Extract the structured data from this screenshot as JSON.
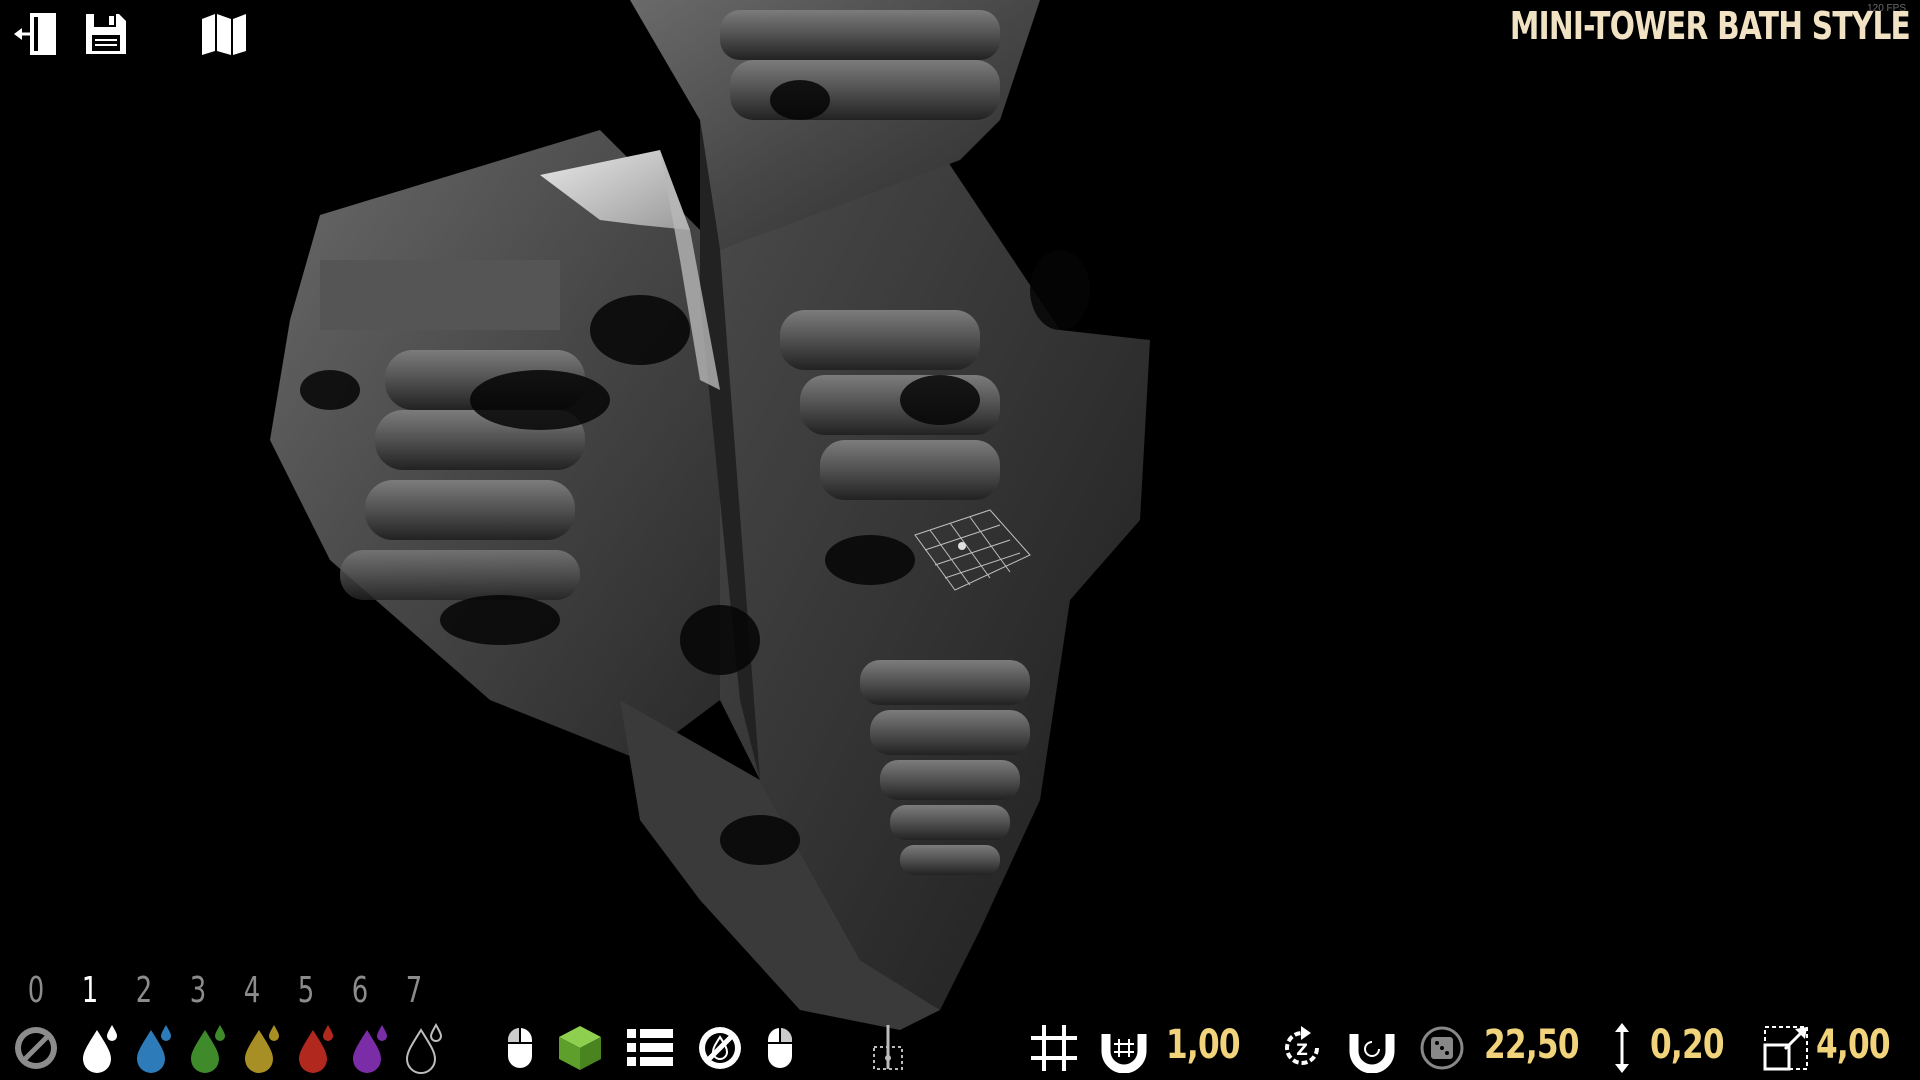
{
  "header": {
    "title": "MINI-TOWER BATH STYLE",
    "fps": "120 FPS"
  },
  "toolbar": {
    "exit_icon": "exit-door-icon",
    "save_icon": "floppy-save-icon",
    "map_icon": "map-icon"
  },
  "paint_slots": [
    {
      "number": "0",
      "color": "none"
    },
    {
      "number": "1",
      "color": "#ffffff"
    },
    {
      "number": "2",
      "color": "#2d7bb8"
    },
    {
      "number": "3",
      "color": "#3f8a2a"
    },
    {
      "number": "4",
      "color": "#a88f25"
    },
    {
      "number": "5",
      "color": "#b1281f"
    },
    {
      "number": "6",
      "color": "#7a2da6"
    },
    {
      "number": "7",
      "color": "outline"
    }
  ],
  "active_slot": "1",
  "tools": {
    "mouse_left": "mouse-left-icon",
    "block": "green-cube-icon",
    "list": "list-icon",
    "no_paint": "no-paint-icon",
    "mouse_right": "mouse-right-icon",
    "axis": "axis-pivot-icon"
  },
  "settings": {
    "grid_snap_value": "1,00",
    "rotation_snap_value": "22,50",
    "height_value": "0,20",
    "scale_value": "4,00"
  }
}
